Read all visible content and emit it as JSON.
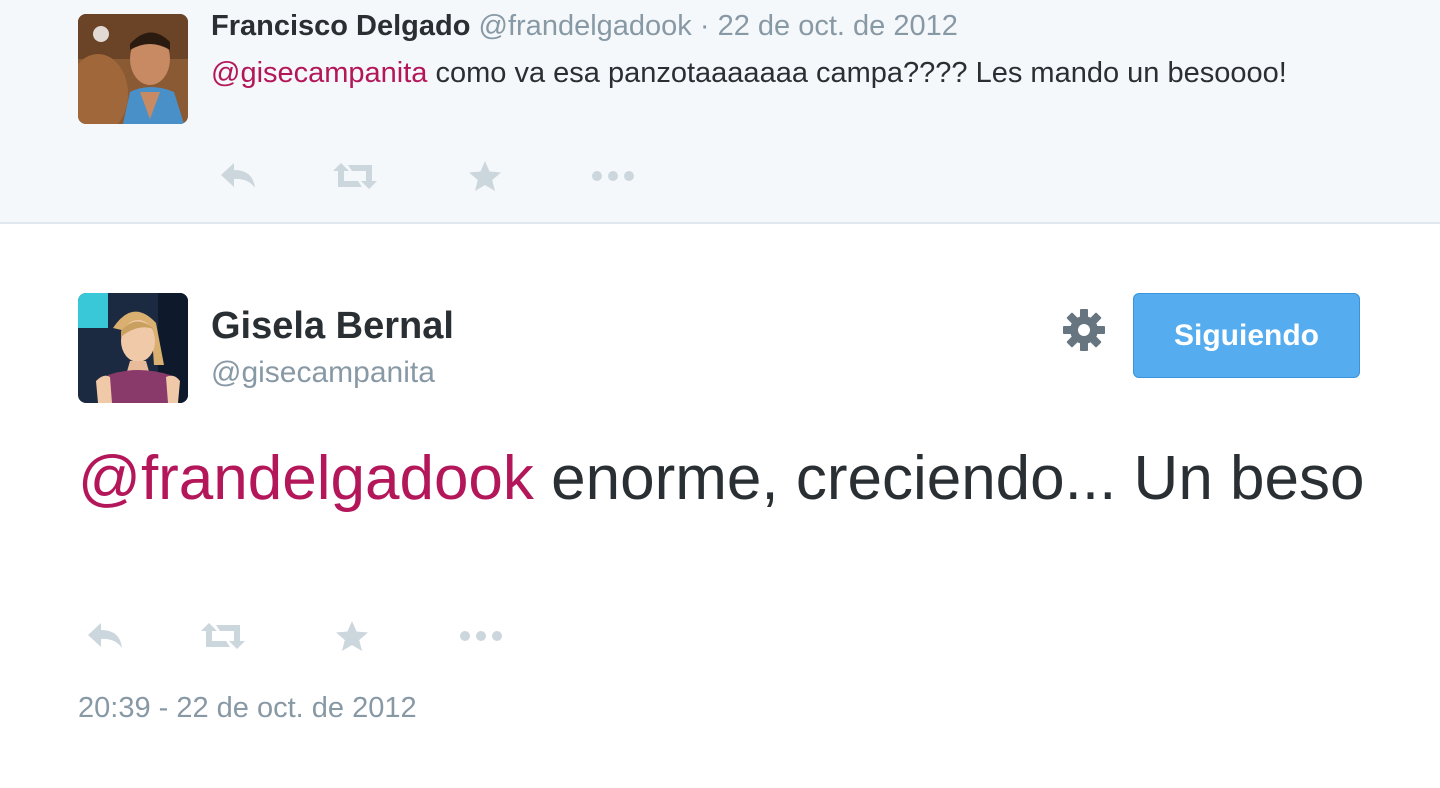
{
  "reply_tweet": {
    "author_name": "Francisco Delgado",
    "author_handle": "@frandelgadook",
    "separator": "·",
    "date": "22 de oct. de 2012",
    "mention": "@gisecampanita",
    "text": " como va esa panzotaaaaaaa campa???? Les mando un besoooo!"
  },
  "main_tweet": {
    "author_name": "Gisela Bernal",
    "author_handle": "@gisecampanita",
    "follow_label": "Siguiendo",
    "mention": "@frandelgadook",
    "text": " enorme, creciendo... Un beso",
    "timestamp": "20:39 - 22 de oct. de 2012"
  },
  "icons": {
    "reply": "reply-icon",
    "retweet": "retweet-icon",
    "favorite": "star-icon",
    "more": "more-icon",
    "settings": "gear-icon"
  },
  "colors": {
    "mention": "#b3175a",
    "muted": "#8899a6",
    "action_icon": "#ccd6dd",
    "follow_button": "#55acee"
  }
}
